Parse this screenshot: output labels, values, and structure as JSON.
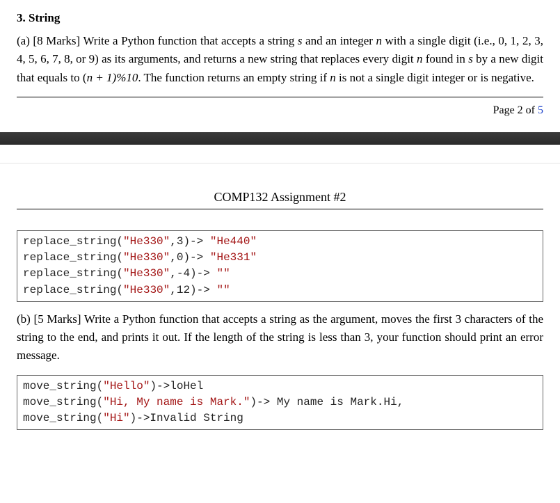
{
  "q3": {
    "heading": "3. String",
    "part_a": {
      "label": "(a) [8 Marks] ",
      "text_before_s": "Write a Python function that accepts a string ",
      "var_s": "s",
      "text_mid1": " and an integer ",
      "var_n": "n",
      "text_mid2": " with a single digit (i.e., 0, 1, 2, 3, 4, 5, 6, 7, 8, or 9) as its arguments, and returns a new string that replaces every digit ",
      "var_n2": "n",
      "text_mid3": " found in ",
      "var_s2": "s",
      "text_mid4": " by a new digit that equals to (",
      "formula": "n + 1)%10",
      "text_mid5": ". The function returns an empty string if ",
      "var_n3": "n",
      "text_tail": " is not a single digit integer or is negative."
    },
    "part_b": {
      "label": "(b) [5 Marks] ",
      "text": "Write a Python function that accepts a string as the argument, moves the first 3 characters of the string to the end, and prints it out. If the length of the string is less than 3, your function should print an error message."
    }
  },
  "page_footer": {
    "prefix": "Page ",
    "current": "2",
    "of": " of ",
    "total": "5"
  },
  "header2": {
    "title": "COMP132  Assignment #2"
  },
  "code_a": {
    "l1_fn": "replace_string(",
    "l1_str": "\"He330\"",
    "l1_sep": ",3)-> ",
    "l1_out": "\"He440\"",
    "l2_fn": "replace_string(",
    "l2_str": "\"He330\"",
    "l2_sep": ",0)-> ",
    "l2_out": "\"He331\"",
    "l3_fn": "replace_string(",
    "l3_str": "\"He330\"",
    "l3_sep": ",-4)-> ",
    "l3_out": "\"\"",
    "l4_fn": "replace_string(",
    "l4_str": "\"He330\"",
    "l4_sep": ",12)-> ",
    "l4_out": "\"\""
  },
  "code_b": {
    "l1_fn": "move_string(",
    "l1_str": "\"Hello\"",
    "l1_tail": ")->loHel",
    "l2_fn": "move_string(",
    "l2_str": "\"Hi, My name is Mark.\"",
    "l2_tail": ")-> My name is Mark.Hi,",
    "l3_fn": "move_string(",
    "l3_str": "\"Hi\"",
    "l3_tail": ")->Invalid String"
  }
}
